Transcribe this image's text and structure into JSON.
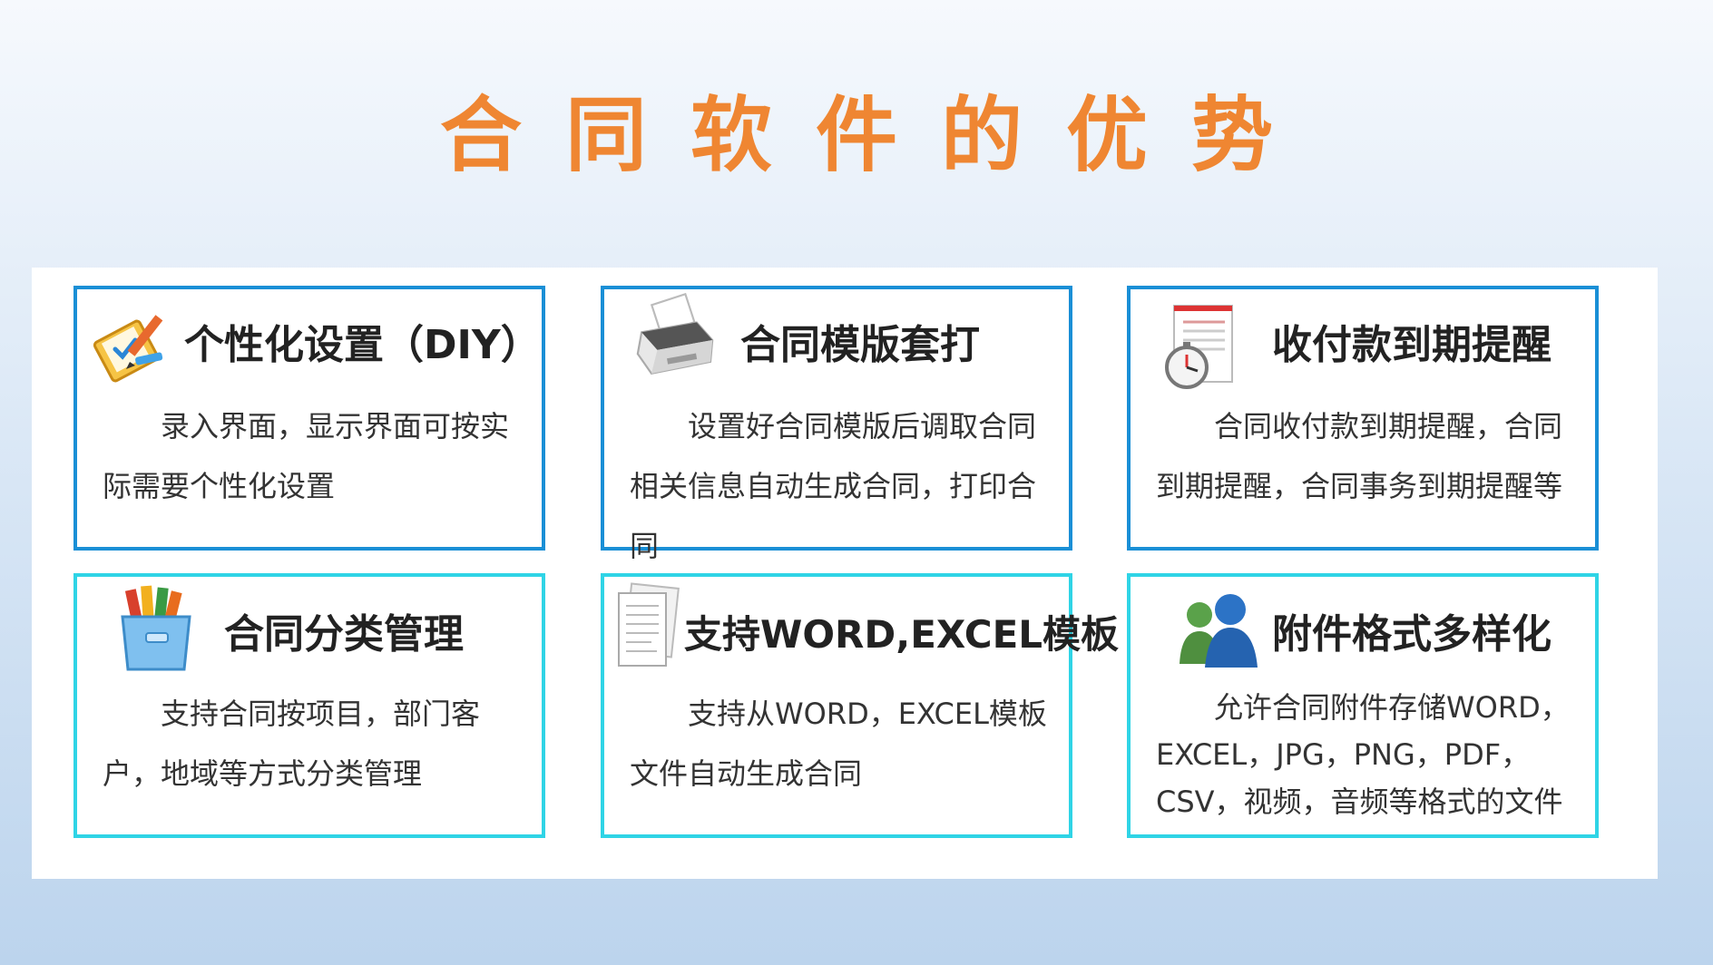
{
  "title": "合同软件的优势",
  "cards": [
    {
      "title": "个性化设置（DIY）",
      "desc": "录入界面，显示界面可按实际需要个性化设置",
      "icon": "clipboard-pencil-icon"
    },
    {
      "title": "合同模版套打",
      "desc": "设置好合同模版后调取合同相关信息自动生成合同，打印合同",
      "icon": "printer-icon"
    },
    {
      "title": "收付款到期提醒",
      "desc": "合同收付款到期提醒，合同到期提醒，合同事务到期提醒等",
      "icon": "stopwatch-document-icon"
    },
    {
      "title": "合同分类管理",
      "desc": "支持合同按项目，部门客户，地域等方式分类管理",
      "icon": "folder-books-icon"
    },
    {
      "title": "支持WORD,EXCEL模板",
      "desc": "支持从WORD，EXCEL模板文件自动生成合同",
      "icon": "documents-icon"
    },
    {
      "title": "附件格式多样化",
      "desc": "允许合同附件存储WORD，EXCEL，JPG，PNG，PDF，CSV，视频，音频等格式的文件",
      "icon": "users-icon"
    }
  ]
}
